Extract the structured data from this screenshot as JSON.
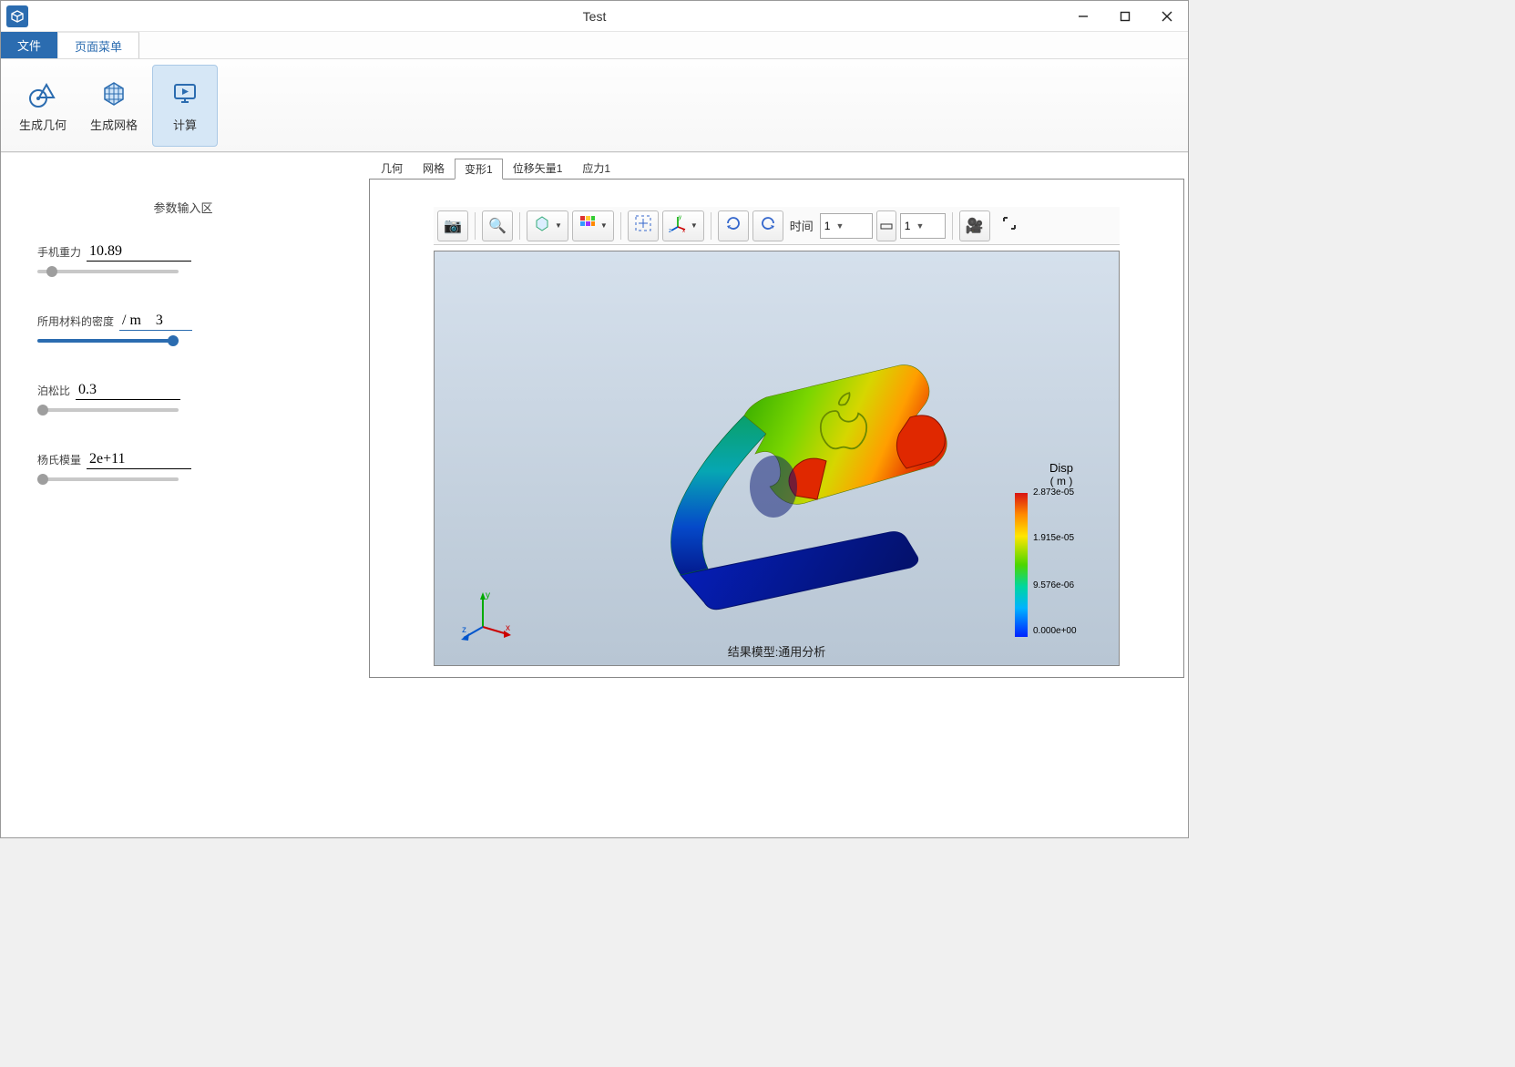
{
  "window": {
    "title": "Test"
  },
  "menubar": {
    "file": "文件",
    "page_menu": "页面菜单"
  },
  "ribbon": {
    "gen_geometry": "生成几何",
    "gen_mesh": "生成网格",
    "compute": "计算"
  },
  "sidebar": {
    "title": "参数输入区",
    "params": {
      "phone_weight": {
        "label": "手机重力",
        "value": "10.89"
      },
      "material_density": {
        "label": "所用材料的密度",
        "value": "/ m    3"
      },
      "poisson": {
        "label": "泊松比",
        "value": "0.3"
      },
      "young_modulus": {
        "label": "杨氏模量",
        "value": "2e+11"
      }
    }
  },
  "viewtabs": {
    "geometry": "几何",
    "mesh": "网格",
    "deform1": "变形1",
    "disp_vec1": "位移矢量1",
    "stress1": "应力1"
  },
  "toolbar": {
    "time_label": "时间",
    "combo1": "1",
    "combo2": "1"
  },
  "canvas": {
    "result_caption": "结果模型:通用分析",
    "axes": {
      "x": "x",
      "y": "y",
      "z": "z"
    },
    "legend": {
      "title": "Disp",
      "unit": "( m )",
      "ticks": [
        "2.873e-05",
        "1.915e-05",
        "9.576e-06",
        "0.000e+00"
      ]
    }
  }
}
